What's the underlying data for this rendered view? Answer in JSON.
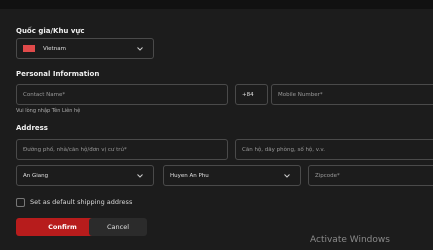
{
  "region": {
    "title": "Quốc gia/Khu vực",
    "country": "Vietnam"
  },
  "personal": {
    "title": "Personal Information",
    "contact_name_placeholder": "Contact Name*",
    "country_code": "+84",
    "mobile_placeholder": "Mobile Number*",
    "helper_text": "Vui lòng nhập Tên Liên hệ"
  },
  "address": {
    "title": "Address",
    "street_placeholder": "Đường phố, nhà/căn hộ/đơn vị cư trú*",
    "apartment_placeholder": "Căn hộ, dãy phòng, số hộ, v.v.",
    "province": "An Giang",
    "district": "Huyen An Phu",
    "zipcode_placeholder": "Zipcode*"
  },
  "default_shipping_label": "Set as default shipping address",
  "actions": {
    "confirm": "Confirm",
    "cancel": "Cancel"
  },
  "watermark": "Activate Windows",
  "colors": {
    "background": "#1c1c1c",
    "accent": "#b71c1c",
    "flag": "#e04a4a"
  }
}
